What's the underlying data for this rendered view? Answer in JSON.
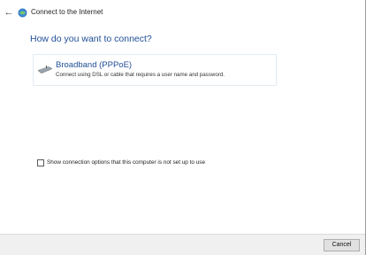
{
  "window": {
    "title": "Connect to the Internet"
  },
  "main": {
    "heading": "How do you want to connect?",
    "options": [
      {
        "title": "Broadband (PPPoE)",
        "description": "Connect using DSL or cable that requires a user name and password.",
        "icon": "broadband-modem-icon"
      }
    ],
    "show_options_checkbox": {
      "label": "Show connection options that this computer is not set up to use",
      "checked": false
    }
  },
  "footer": {
    "cancel_label": "Cancel"
  },
  "colors": {
    "heading": "#1f4e96",
    "footer_bg": "#f0f0f0"
  }
}
